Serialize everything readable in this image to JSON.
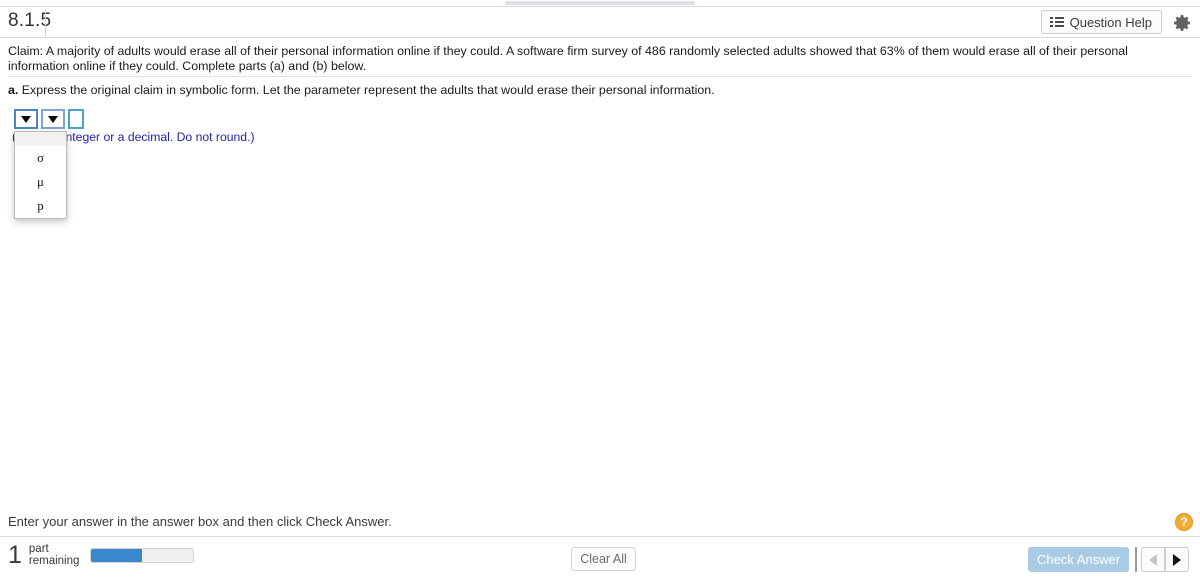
{
  "header": {
    "exercise_number": "8.1.5",
    "question_help_label": "Question Help",
    "question_help_icon": "list-icon",
    "settings_icon": "gear-icon"
  },
  "question": {
    "claim_text": "Claim: A majority of adults would erase all of their personal information online if they could. A software firm survey of 486 randomly selected adults showed that 63% of them would erase all of their personal information online if they could. Complete parts (a) and (b) below.",
    "part_a_label": "a.",
    "part_a_text": "Express the original claim in symbolic form. Let the parameter represent the adults that would erase their personal information.",
    "hint_text": "(Type an integer or a decimal. Do not round.)"
  },
  "answer": {
    "parameter_select": {
      "value": "",
      "arrow_icon": "chevron-down-icon",
      "options": [
        "",
        "σ",
        "μ",
        "p"
      ],
      "open": true
    },
    "operator_select": {
      "value": "",
      "arrow_icon": "chevron-down-icon"
    },
    "value_input": {
      "value": "",
      "placeholder": ""
    }
  },
  "footer": {
    "message": "Enter your answer in the answer box and then click Check Answer.",
    "help_icon_label": "?",
    "parts_remaining_count": "1",
    "parts_remaining_label_line1": "part",
    "parts_remaining_label_line2": "remaining",
    "progress_percent": 50,
    "clear_all_label": "Clear All",
    "check_answer_label": "Check Answer",
    "prev_icon": "triangle-left-icon",
    "next_icon": "triangle-right-icon"
  },
  "colors": {
    "accent_blue": "#3b87cd",
    "check_answer_bg": "#a9cbe6",
    "hint_blue": "#2222a8",
    "help_orange": "#f0ad31",
    "select_border": "#7ea6cf",
    "input_border": "#4aa3c7"
  }
}
